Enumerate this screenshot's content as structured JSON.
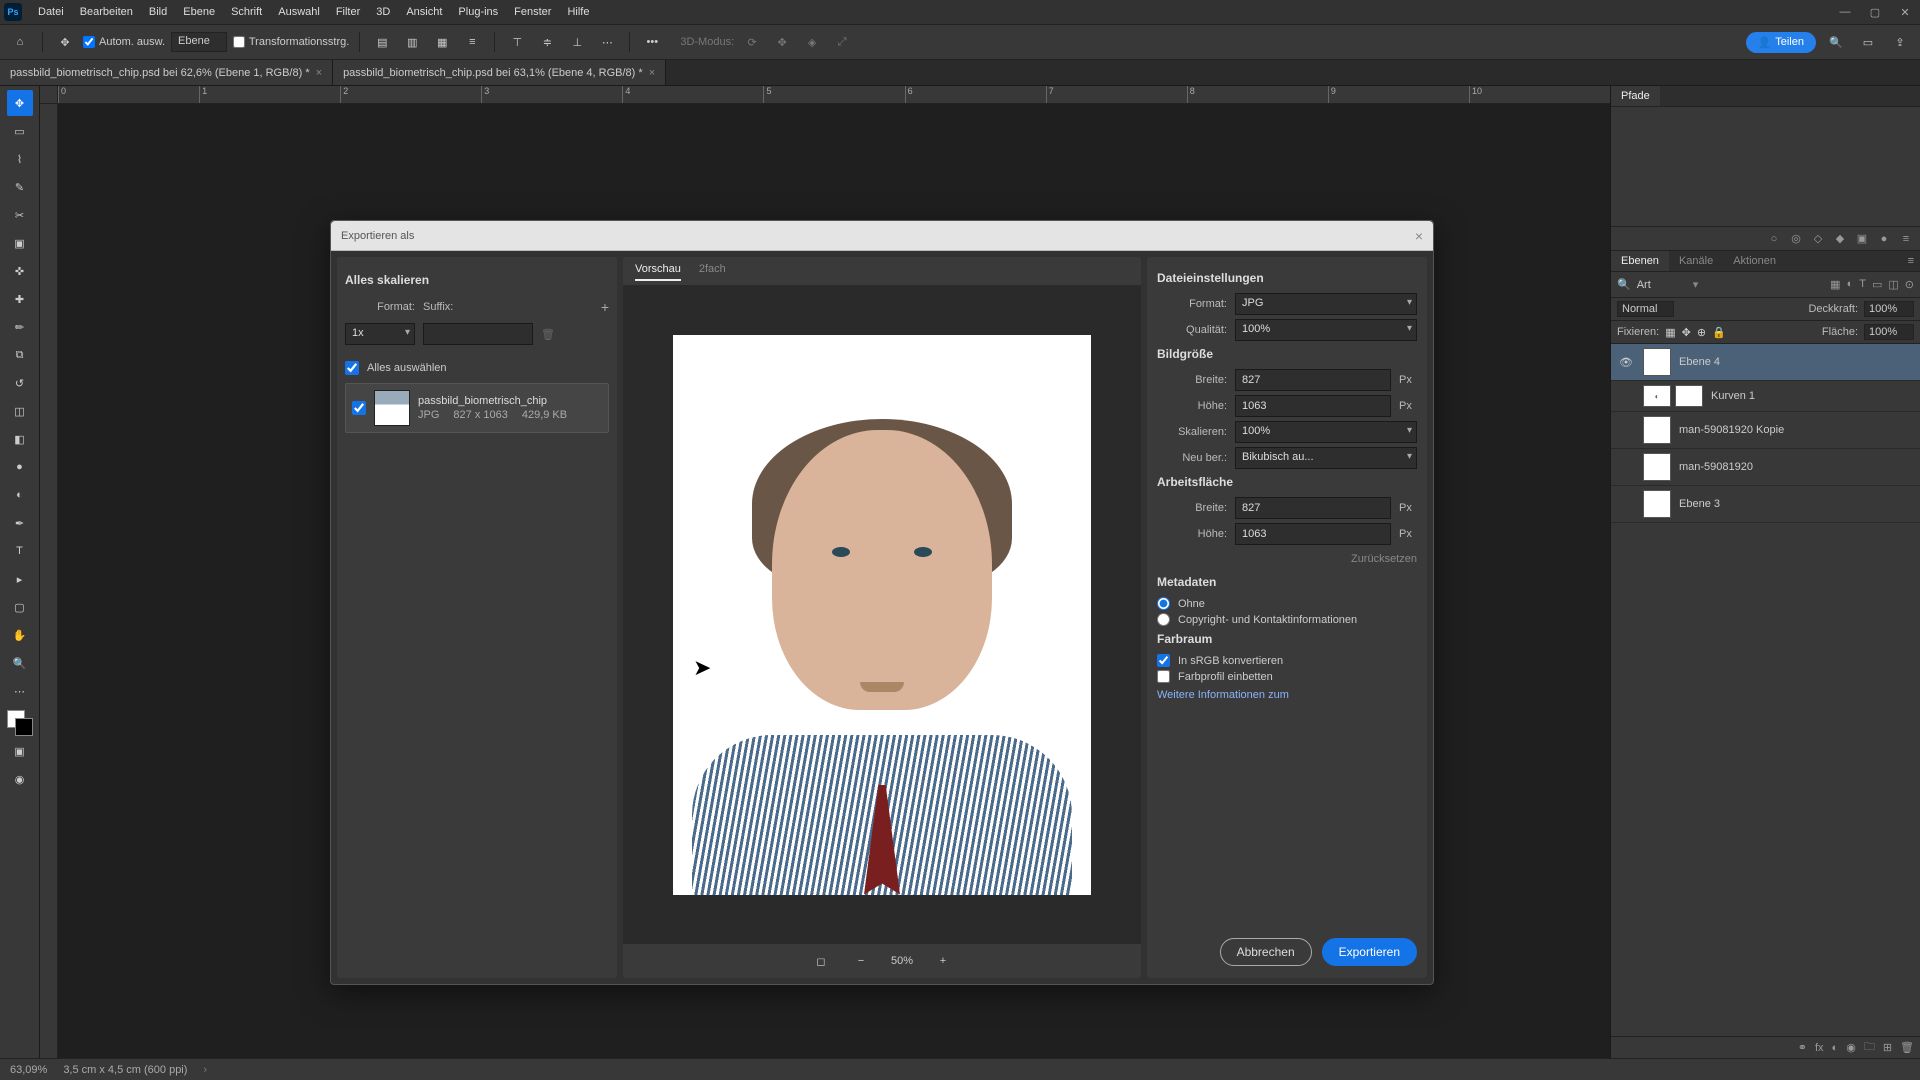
{
  "menubar": {
    "logo": "Ps",
    "items": [
      "Datei",
      "Bearbeiten",
      "Bild",
      "Ebene",
      "Schrift",
      "Auswahl",
      "Filter",
      "3D",
      "Ansicht",
      "Plug-ins",
      "Fenster",
      "Hilfe"
    ]
  },
  "optionsbar": {
    "auto_select": "Autom. ausw.",
    "target": "Ebene",
    "transform": "Transformationsstrg.",
    "mode3d": "3D-Modus:",
    "share": "Teilen"
  },
  "doctabs": [
    "passbild_biometrisch_chip.psd bei 62,6% (Ebene 1, RGB/8) *",
    "passbild_biometrisch_chip.psd bei 63,1% (Ebene 4, RGB/8) *"
  ],
  "ruler_h": [
    "0",
    "1",
    "2",
    "3",
    "4",
    "5",
    "6",
    "7",
    "8",
    "9",
    "10"
  ],
  "panels": {
    "paths": "Pfade",
    "tabs": [
      "Ebenen",
      "Kanäle",
      "Aktionen"
    ],
    "search": "Art",
    "blend_mode": "Normal",
    "opacity_label": "Deckkraft:",
    "opacity": "100%",
    "lock_label": "Fixieren:",
    "fill_label": "Fläche:",
    "fill": "100%",
    "layers": [
      {
        "name": "Ebene 4",
        "selected": true,
        "visible": true,
        "mask": false
      },
      {
        "name": "Kurven 1",
        "selected": false,
        "visible": false,
        "mask": true
      },
      {
        "name": "man-59081920 Kopie",
        "selected": false,
        "visible": false,
        "mask": false
      },
      {
        "name": "man-59081920",
        "selected": false,
        "visible": false,
        "mask": false
      },
      {
        "name": "Ebene 3",
        "selected": false,
        "visible": false,
        "mask": false
      }
    ]
  },
  "statusbar": {
    "zoom": "63,09%",
    "docinfo": "3,5 cm x 4,5 cm (600 ppi)"
  },
  "dialog": {
    "title": "Exportieren als",
    "left": {
      "scale_all": "Alles skalieren",
      "format": "Format:",
      "suffix": "Suffix:",
      "scale_value": "1x",
      "select_all": "Alles auswählen",
      "asset": {
        "name": "passbild_biometrisch_chip",
        "fmt": "JPG",
        "dims": "827 x 1063",
        "size": "429,9 KB"
      }
    },
    "mid": {
      "tab_preview": "Vorschau",
      "tab_2x": "2fach",
      "zoom": "50%"
    },
    "right": {
      "file_settings": "Dateieinstellungen",
      "format": "Format:",
      "format_v": "JPG",
      "quality": "Qualität:",
      "quality_v": "100%",
      "image_size": "Bildgröße",
      "width": "Breite:",
      "width_v": "827",
      "height": "Höhe:",
      "height_v": "1063",
      "scale": "Skalieren:",
      "scale_v": "100%",
      "resample": "Neu ber.:",
      "resample_v": "Bikubisch au...",
      "canvas": "Arbeitsfläche",
      "c_width_v": "827",
      "c_height_v": "1063",
      "px": "Px",
      "reset": "Zurücksetzen",
      "metadata": "Metadaten",
      "meta_none": "Ohne",
      "meta_cc": "Copyright- und Kontaktinformationen",
      "colorspace": "Farbraum",
      "to_srgb": "In sRGB konvertieren",
      "embed": "Farbprofil einbetten",
      "more": "Weitere Informationen zum",
      "cancel": "Abbrechen",
      "export": "Exportieren"
    }
  }
}
